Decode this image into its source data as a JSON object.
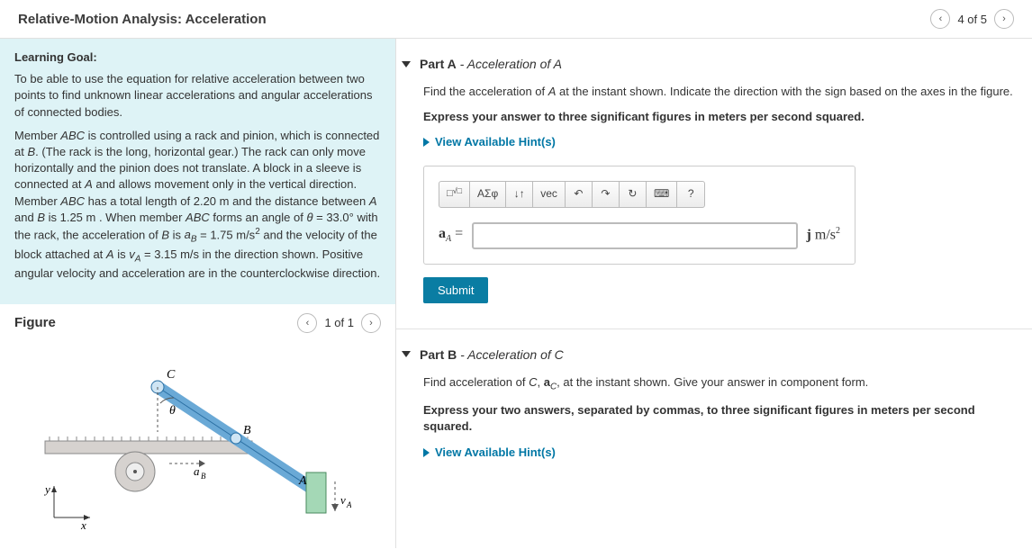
{
  "header": {
    "title": "Relative-Motion Analysis: Acceleration",
    "pager_label": "4 of 5"
  },
  "learning_goal": {
    "title": "Learning Goal:",
    "p1": "To be able to use the equation for relative acceleration between two points to find unknown linear accelerations and angular accelerations of connected bodies.",
    "p2_html": "Member <span class='ital'>ABC</span> is controlled using a rack and pinion, which is connected at <span class='ital'>B</span>. (The rack is the long, horizontal gear.) The rack can only move horizontally and the pinion does not translate. A block in a sleeve is connected at <span class='ital'>A</span> and allows movement only in the vertical direction. Member <span class='ital'>ABC</span> has a total length of 2.20 m and the distance between <span class='ital'>A</span> and <span class='ital'>B</span> is 1.25 m . When member <span class='ital'>ABC</span> forms an angle of <span class='ital'>θ</span> = 33.0° with the rack, the acceleration of <span class='ital'>B</span> is <span class='ital'>a<span class='sub'>B</span></span> = 1.75 m/s<span class='sup'>2</span> and the velocity of the block attached at <span class='ital'>A</span> is <span class='ital'>v<span class='sub'>A</span></span> = 3.15 m/s in the direction shown. Positive angular velocity and acceleration are in the counterclockwise direction."
  },
  "figure": {
    "title": "Figure",
    "pager": "1 of 1",
    "labels": {
      "C": "C",
      "B": "B",
      "A": "A",
      "theta": "θ",
      "aB": "aB",
      "vA": "vA",
      "x": "x",
      "y": "y"
    }
  },
  "partA": {
    "title_prefix": "Part A",
    "title_rest": " - Acceleration of A",
    "prompt_html": "Find the acceleration of <span class='ital'>A</span> at the instant shown. Indicate the direction with the sign based on the axes in the figure.",
    "instructions": "Express your answer to three significant figures in meters per second squared.",
    "hints_label": "View Available Hint(s)",
    "lhs_html": "<b>a</b><span class='sub ital'>A</span> =",
    "units_html": "<b>j</b> m/s<span class='sup'>2</span>",
    "submit": "Submit"
  },
  "partB": {
    "title_prefix": "Part B",
    "title_rest": " - Acceleration of C",
    "prompt_html": "Find acceleration of <span class='ital'>C</span>, <b>a</b><span class='sub ital'>C</span>, at the instant shown. Give your answer in component form.",
    "instructions": "Express your two answers, separated by commas, to three significant figures in meters per second squared.",
    "hints_label": "View Available Hint(s)"
  },
  "toolbar": {
    "templates": "⎕√⎕",
    "greek": "ΑΣφ",
    "subsup": "↓↑",
    "vec": "vec",
    "undo": "↶",
    "redo": "↷",
    "reset": "↻",
    "keyboard": "⌨",
    "help": "?"
  }
}
